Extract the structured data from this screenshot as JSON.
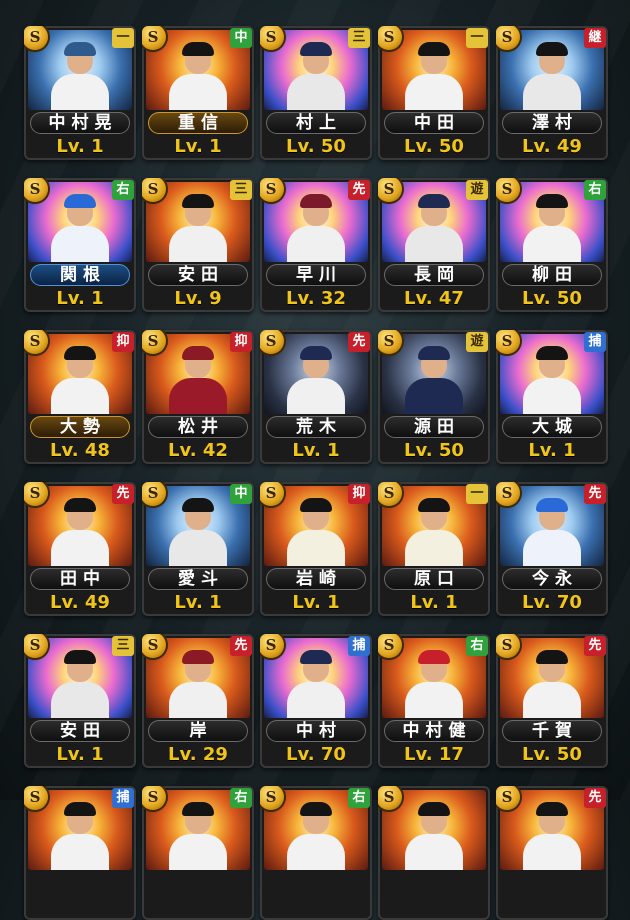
{
  "screen": {
    "title": ""
  },
  "colors": {
    "level": "#f0c419",
    "badge_gold": "#e0a21b"
  },
  "cards": [
    {
      "name": "中村晃",
      "level": "Lv. 1",
      "pos": "一",
      "pos_color": "yellow",
      "band": "default",
      "theme": "cool",
      "cap": "#2e5a8c",
      "shirt": "#f2f2f2"
    },
    {
      "name": "重信",
      "level": "Lv. 1",
      "pos": "中",
      "pos_color": "green",
      "band": "gold",
      "theme": "warm",
      "cap": "#141414",
      "shirt": "#f2f2f2"
    },
    {
      "name": "村上",
      "level": "Lv. 50",
      "pos": "三",
      "pos_color": "yellow",
      "band": "default",
      "theme": "mixed",
      "cap": "#1e2a52",
      "shirt": "#e8e8e8"
    },
    {
      "name": "中田",
      "level": "Lv. 50",
      "pos": "一",
      "pos_color": "yellow",
      "band": "default",
      "theme": "warm",
      "cap": "#141414",
      "shirt": "#f2f2f2"
    },
    {
      "name": "澤村",
      "level": "Lv. 49",
      "pos": "継",
      "pos_color": "red",
      "band": "default",
      "theme": "cool",
      "cap": "#141414",
      "shirt": "#e8e8e8"
    },
    {
      "name": "関根",
      "level": "Lv. 1",
      "pos": "右",
      "pos_color": "green",
      "band": "blue",
      "theme": "mixed",
      "cap": "#2a6ad6",
      "shirt": "#eef2fa"
    },
    {
      "name": "安田",
      "level": "Lv. 9",
      "pos": "三",
      "pos_color": "yellow",
      "band": "default",
      "theme": "warm",
      "cap": "#141414",
      "shirt": "#f0f0f0"
    },
    {
      "name": "早川",
      "level": "Lv. 32",
      "pos": "先",
      "pos_color": "red",
      "band": "default",
      "theme": "mixed",
      "cap": "#7a1a2a",
      "shirt": "#f0f0f0"
    },
    {
      "name": "長岡",
      "level": "Lv. 47",
      "pos": "遊",
      "pos_color": "yellow",
      "band": "default",
      "theme": "mixed",
      "cap": "#1e2a52",
      "shirt": "#e8e8e8"
    },
    {
      "name": "柳田",
      "level": "Lv. 50",
      "pos": "右",
      "pos_color": "green",
      "band": "default",
      "theme": "mixed",
      "cap": "#141414",
      "shirt": "#f2f2f2"
    },
    {
      "name": "大勢",
      "level": "Lv. 48",
      "pos": "抑",
      "pos_color": "red",
      "band": "gold",
      "theme": "warm",
      "cap": "#141414",
      "shirt": "#f2f2f2"
    },
    {
      "name": "松井",
      "level": "Lv. 42",
      "pos": "抑",
      "pos_color": "red",
      "band": "default",
      "theme": "warm",
      "cap": "#8a1a26",
      "shirt": "#9a1a2a"
    },
    {
      "name": "荒木",
      "level": "Lv. 1",
      "pos": "先",
      "pos_color": "red",
      "band": "default",
      "theme": "dark",
      "cap": "#1e2a52",
      "shirt": "#f0f0f0"
    },
    {
      "name": "源田",
      "level": "Lv. 50",
      "pos": "遊",
      "pos_color": "yellow",
      "band": "default",
      "theme": "dark",
      "cap": "#1e2a52",
      "shirt": "#1e2a52"
    },
    {
      "name": "大城",
      "level": "Lv. 1",
      "pos": "捕",
      "pos_color": "blue",
      "band": "default",
      "theme": "mixed",
      "cap": "#141414",
      "shirt": "#f2f2f2"
    },
    {
      "name": "田中",
      "level": "Lv. 49",
      "pos": "先",
      "pos_color": "red",
      "band": "default",
      "theme": "warm",
      "cap": "#141414",
      "shirt": "#f2f2f2"
    },
    {
      "name": "愛斗",
      "level": "Lv. 1",
      "pos": "中",
      "pos_color": "green",
      "band": "default",
      "theme": "cool",
      "cap": "#141414",
      "shirt": "#e8e8e8"
    },
    {
      "name": "岩崎",
      "level": "Lv. 1",
      "pos": "抑",
      "pos_color": "red",
      "band": "default",
      "theme": "warm",
      "cap": "#141414",
      "shirt": "#f4f0e0"
    },
    {
      "name": "原口",
      "level": "Lv. 1",
      "pos": "一",
      "pos_color": "yellow",
      "band": "default",
      "theme": "warm",
      "cap": "#141414",
      "shirt": "#f4f0e0"
    },
    {
      "name": "今永",
      "level": "Lv. 70",
      "pos": "先",
      "pos_color": "red",
      "band": "default",
      "theme": "cool",
      "cap": "#2a6ad6",
      "shirt": "#eef2fa"
    },
    {
      "name": "安田",
      "level": "Lv. 1",
      "pos": "三",
      "pos_color": "yellow",
      "band": "default",
      "theme": "mixed",
      "cap": "#141414",
      "shirt": "#e8e8e8"
    },
    {
      "name": "岸",
      "level": "Lv. 29",
      "pos": "先",
      "pos_color": "red",
      "band": "default",
      "theme": "warm",
      "cap": "#8a1a26",
      "shirt": "#f0f0f0"
    },
    {
      "name": "中村",
      "level": "Lv. 70",
      "pos": "捕",
      "pos_color": "blue",
      "band": "default",
      "theme": "mixed",
      "cap": "#1e2a52",
      "shirt": "#f0f0f0"
    },
    {
      "name": "中村健",
      "level": "Lv. 17",
      "pos": "右",
      "pos_color": "green",
      "band": "default",
      "theme": "warm",
      "cap": "#c8202b",
      "shirt": "#f2f2f2"
    },
    {
      "name": "千賀",
      "level": "Lv. 50",
      "pos": "先",
      "pos_color": "red",
      "band": "default",
      "theme": "warm",
      "cap": "#141414",
      "shirt": "#f2f2f2"
    },
    {
      "name": "",
      "level": "",
      "pos": "捕",
      "pos_color": "blue",
      "band": "default",
      "theme": "warm",
      "cap": "#141414",
      "shirt": "#f2f2f2"
    },
    {
      "name": "",
      "level": "",
      "pos": "右",
      "pos_color": "green",
      "band": "default",
      "theme": "warm",
      "cap": "#141414",
      "shirt": "#f2f2f2"
    },
    {
      "name": "",
      "level": "",
      "pos": "右",
      "pos_color": "green",
      "band": "default",
      "theme": "warm",
      "cap": "#141414",
      "shirt": "#f2f2f2"
    },
    {
      "name": "",
      "level": "",
      "pos": "",
      "pos_color": "yellow",
      "band": "default",
      "theme": "warm",
      "cap": "#141414",
      "shirt": "#f2f2f2"
    },
    {
      "name": "",
      "level": "",
      "pos": "先",
      "pos_color": "red",
      "band": "default",
      "theme": "warm",
      "cap": "#141414",
      "shirt": "#f2f2f2"
    }
  ]
}
